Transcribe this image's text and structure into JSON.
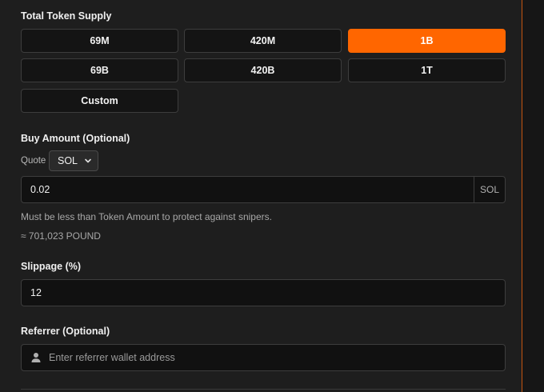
{
  "supply": {
    "label": "Total Token Supply",
    "options": [
      "69M",
      "420M",
      "1B",
      "69B",
      "420B",
      "1T",
      "Custom"
    ],
    "selected": "1B"
  },
  "buy": {
    "label": "Buy Amount (Optional)",
    "quote_label": "Quote",
    "quote_value": "SOL",
    "amount_value": "0.02",
    "amount_suffix": "SOL",
    "hint": "Must be less than Token Amount to protect against snipers.",
    "estimate": "≈ 701,023 POUND"
  },
  "slippage": {
    "label": "Slippage (%)",
    "value": "12"
  },
  "referrer": {
    "label": "Referrer (Optional)",
    "placeholder": "Enter referrer wallet address"
  },
  "colors": {
    "accent": "#ff6600",
    "border_accent": "#c4540f"
  },
  "icons": {
    "referrer_icon": "person-icon",
    "quote_dropdown": "chevron-down-icon"
  }
}
